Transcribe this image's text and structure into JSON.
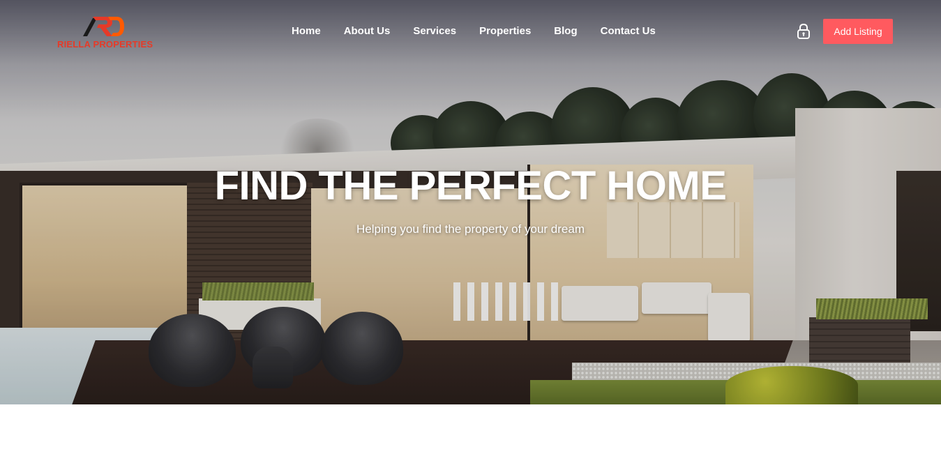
{
  "brand": {
    "logo_text": "RIELLA PROPERTIES",
    "logo_colors": [
      "#e63a28",
      "#ff5a00",
      "#1a1a1a"
    ]
  },
  "nav": {
    "items": [
      {
        "label": "Home"
      },
      {
        "label": "About Us"
      },
      {
        "label": "Services"
      },
      {
        "label": "Properties"
      },
      {
        "label": "Blog"
      },
      {
        "label": "Contact Us"
      }
    ]
  },
  "header_actions": {
    "login_icon": "lock-icon",
    "add_listing_label": "Add Listing",
    "add_listing_color": "#ff5a5f"
  },
  "hero": {
    "title": "FIND THE PERFECT HOME",
    "subtitle": "Helping you find the property of your dream",
    "background_description_icon": "house-photo"
  }
}
